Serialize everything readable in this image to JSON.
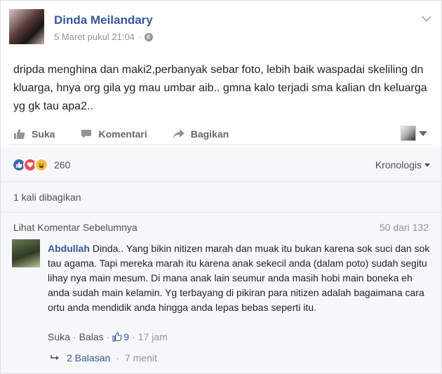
{
  "post": {
    "author": "Dinda Meilandary",
    "date": "5 Maret pukul 21:04",
    "separator": "·",
    "privacy_icon": "globe-icon",
    "text": "dripda menghina dan maki2,perbanyak sebar foto, lebih baik waspadai skeliling dn kluarga, hnya org gila yg mau umbar aib.. gmna kalo terjadi sma kalian dn keluarga yg gk tau apa2.."
  },
  "actions": {
    "like": "Suka",
    "comment": "Komentari",
    "share": "Bagikan"
  },
  "reactions": {
    "icons": [
      "like-reaction-icon",
      "love-reaction-icon",
      "haha-reaction-icon"
    ],
    "count": "260",
    "sort": "Kronologis"
  },
  "shares": {
    "text": "1 kali dibagikan"
  },
  "comments": {
    "previous_label": "Lihat Komentar Sebelumnya",
    "page_count": "50 dari 132",
    "items": [
      {
        "author": "Abdullah",
        "text": "Dinda.. Yang bikin nitizen marah dan muak itu bukan karena sok suci dan sok tau agama. Tapi mereka marah itu karena anak sekecil anda (dalam poto) sudah segitu lihay nya main mesum. Di mana anak lain seumur anda masih hobi main boneka eh anda sudah main kelamin. Yg terbayang di pikiran para nitizen adalah bagaimana cara ortu anda mendidik anda hingga anda lepas bebas seperti itu.",
        "like_label": "Suka",
        "dot": "·",
        "reply_label": "Balas",
        "like_count": "9",
        "time": "17 jam",
        "replies_label": "2 Balasan",
        "replies_time": "7 menit"
      }
    ]
  },
  "colors": {
    "link": "#365899",
    "muted": "#90949c",
    "like_reaction": "#4267b2",
    "love_reaction": "#e84b5a",
    "haha_reaction": "#f7c142"
  }
}
